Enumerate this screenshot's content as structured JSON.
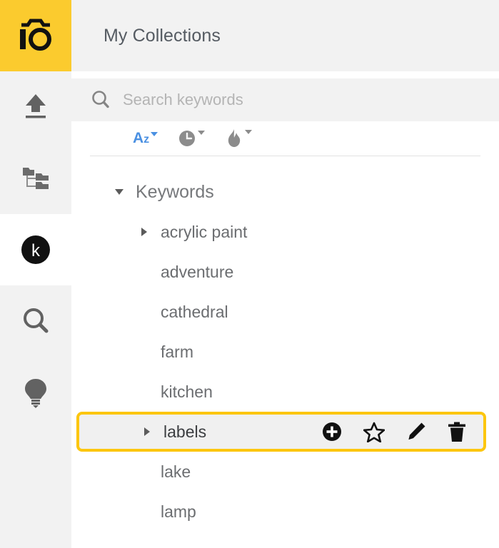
{
  "app": {
    "logo_icon": "camera-io-logo",
    "brand_color": "#fbcb2e",
    "accent_color": "#fcc60f",
    "active_sort_color": "#4a90e2"
  },
  "sidebar": {
    "items": [
      {
        "name": "upload",
        "icon": "upload-icon",
        "active": false
      },
      {
        "name": "catalog-tree",
        "icon": "folder-tree-icon",
        "active": false
      },
      {
        "name": "keywords",
        "icon": "k-badge-icon",
        "active": true
      },
      {
        "name": "search",
        "icon": "magnifier-icon",
        "active": false
      },
      {
        "name": "ideas",
        "icon": "lightbulb-icon",
        "active": false
      }
    ]
  },
  "header": {
    "title": "My Collections"
  },
  "search": {
    "placeholder": "Search keywords",
    "value": "",
    "icon": "search-icon"
  },
  "sort_toolbar": {
    "buttons": [
      {
        "label": "Az",
        "name": "sort-alphabetical",
        "icon": "az-icon",
        "active": true
      },
      {
        "label": "",
        "name": "sort-recent",
        "icon": "clock-icon",
        "active": false
      },
      {
        "label": "",
        "name": "sort-popular",
        "icon": "flame-icon",
        "active": false
      }
    ]
  },
  "tree": {
    "root": {
      "label": "Keywords",
      "expanded": true
    },
    "items": [
      {
        "label": "acrylic paint",
        "expandable": true,
        "selected": false
      },
      {
        "label": "adventure",
        "expandable": false,
        "selected": false
      },
      {
        "label": "cathedral",
        "expandable": false,
        "selected": false
      },
      {
        "label": "farm",
        "expandable": false,
        "selected": false
      },
      {
        "label": "kitchen",
        "expandable": false,
        "selected": false
      },
      {
        "label": "labels",
        "expandable": true,
        "selected": true
      },
      {
        "label": "lake",
        "expandable": false,
        "selected": false
      },
      {
        "label": "lamp",
        "expandable": false,
        "selected": false
      }
    ],
    "row_actions": [
      {
        "name": "add-child-keyword",
        "icon": "plus-circle-icon"
      },
      {
        "name": "favorite-keyword",
        "icon": "star-icon"
      },
      {
        "name": "edit-keyword",
        "icon": "pencil-icon"
      },
      {
        "name": "delete-keyword",
        "icon": "trash-icon"
      }
    ]
  }
}
